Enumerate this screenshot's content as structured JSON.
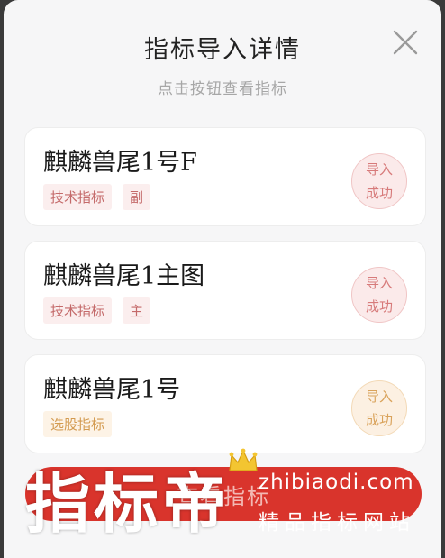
{
  "dialog": {
    "title": "指标导入详情",
    "subtitle": "点击按钮查看指标",
    "close_icon": "close-icon"
  },
  "items": [
    {
      "name": "麒麟兽尾1号F",
      "tags": [
        "技术指标",
        "副"
      ],
      "tag_tone": "red",
      "status": "导入\n成功",
      "status_tone": "red"
    },
    {
      "name": "麒麟兽尾1主图",
      "tags": [
        "技术指标",
        "主"
      ],
      "tag_tone": "red",
      "status": "导入\n成功",
      "status_tone": "red"
    },
    {
      "name": "麒麟兽尾1号",
      "tags": [
        "选股指标"
      ],
      "tag_tone": "orange",
      "status": "导入\n成功",
      "status_tone": "orange"
    }
  ],
  "action_button": {
    "label": "查看指标"
  },
  "watermark": {
    "brand": "指标帝",
    "domain": "zhibiaodi.com",
    "slogan": "精品指标网站",
    "crown_icon": "crown-icon"
  },
  "colors": {
    "accent_red": "#d9342c",
    "tag_red_text": "#c46a6a",
    "tag_orange_text": "#d39a4f"
  }
}
